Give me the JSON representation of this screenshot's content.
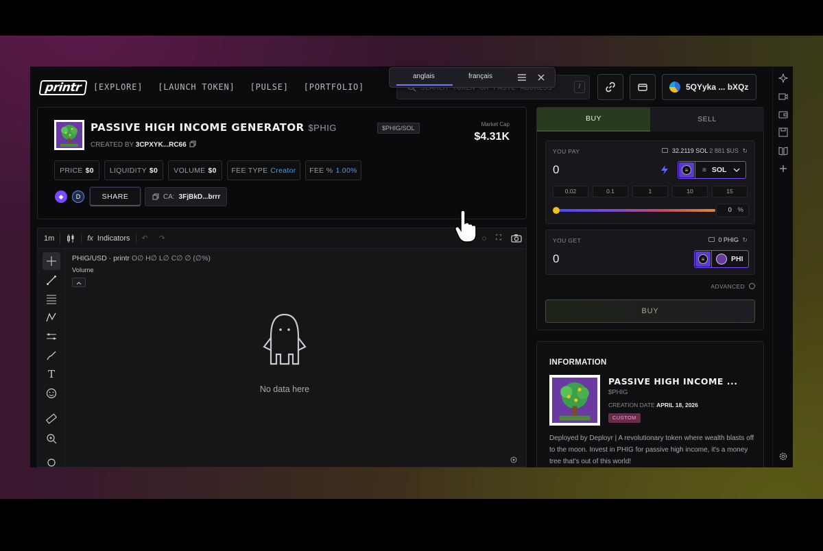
{
  "nav": {
    "logo": "printr",
    "links": [
      "[EXPLORE]",
      "[LAUNCH TOKEN]",
      "[PULSE]",
      "[PORTFOLIO]"
    ],
    "search_placeholder": "SEARCH TOKEN OR PASTE ADDRESS",
    "search_shortcut": "/",
    "wallet_address": "5QYyka ... bXQz"
  },
  "translate_popup": {
    "source_lang": "anglais",
    "target_lang": "français",
    "menu_icon": "hamburger-icon",
    "close_icon": "close-icon"
  },
  "token": {
    "name": "PASSIVE HIGH INCOME GENERATOR",
    "ticker": "$PHIG",
    "pair": "$PHIG/SOL",
    "created_by_label": "CREATED BY",
    "creator": "3CPXYK...RC66",
    "market_cap_label": "Market Cap",
    "market_cap": "$4.31K",
    "stats": [
      {
        "label": "PRICE",
        "value": "$0"
      },
      {
        "label": "LIQUIDITY",
        "value": "$0"
      },
      {
        "label": "VOLUME",
        "value": "$0"
      },
      {
        "label": "FEE TYPE",
        "value": "Creator"
      },
      {
        "label": "FEE %",
        "value": "1.00%"
      }
    ],
    "share_label": "SHARE",
    "ca_label": "CA:",
    "ca_value": "3FjBkD...brrr"
  },
  "chart": {
    "interval": "1m",
    "indicators_label": "Indicators",
    "symbol": "PHIG/USD · printr",
    "ohlc": "O∅ H∅ L∅ C∅ ∅ (∅%)",
    "volume_label": "Volume",
    "empty_text": "No data here"
  },
  "trade": {
    "buy_tab": "BUY",
    "sell_tab": "SELL",
    "pay_label": "YOU PAY",
    "pay_balance": "32.2119 SOL",
    "pay_balance_usd": "2 881 $US",
    "pay_amount": "0",
    "pay_token": "SOL",
    "quick_amounts": [
      "0.02",
      "0.1",
      "1",
      "10",
      "15"
    ],
    "slider_percent": 0,
    "slider_value": "0",
    "percent_sign": "%",
    "get_label": "YOU GET",
    "get_balance": "0 PHIG",
    "get_amount": "0",
    "get_token": "PHI",
    "advanced_label": "ADVANCED",
    "buy_button": "BUY"
  },
  "info": {
    "heading": "INFORMATION",
    "name": "PASSIVE HIGH INCOME ...",
    "ticker": "$PHIG",
    "creation_label": "CREATION DATE",
    "creation_date": "APRIL 18, 2026",
    "badge": "CUSTOM",
    "description": "Deployed by Deployr | A revolutionary token where wealth blasts off to the moon. Invest in PHIG for passive high income, it's a money tree that's out of this world!"
  },
  "colors": {
    "buy_tab_bg": "#2a3a1f",
    "accent_blue": "#3aa0ff",
    "token_select_border": "#7a4aff",
    "custom_badge_bg": "#6a2a4a"
  }
}
